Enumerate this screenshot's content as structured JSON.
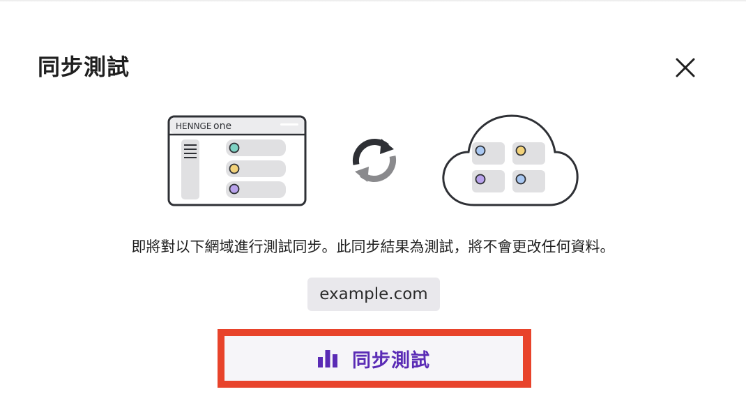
{
  "dialog": {
    "title": "同步測試",
    "description": "即將對以下網域進行測試同步。此同步結果為測試，將不會更改任何資料。",
    "domain": "example.com",
    "action_label": "同步測試"
  },
  "illustration": {
    "app_logo_text_a": "HENNGE",
    "app_logo_text_b": "one"
  },
  "colors": {
    "accent": "#5a2bb5",
    "highlight": "#e8432b",
    "chip_bg": "#e9e8ec",
    "dot_teal": "#7fd3c4",
    "dot_yellow": "#f2d27a",
    "dot_purple": "#b9a3ec",
    "dot_blue": "#a9c8f2"
  },
  "icons": {
    "close": "close-icon",
    "sync": "sync-icon",
    "chart": "bar-chart-icon",
    "cloud": "cloud-icon"
  }
}
